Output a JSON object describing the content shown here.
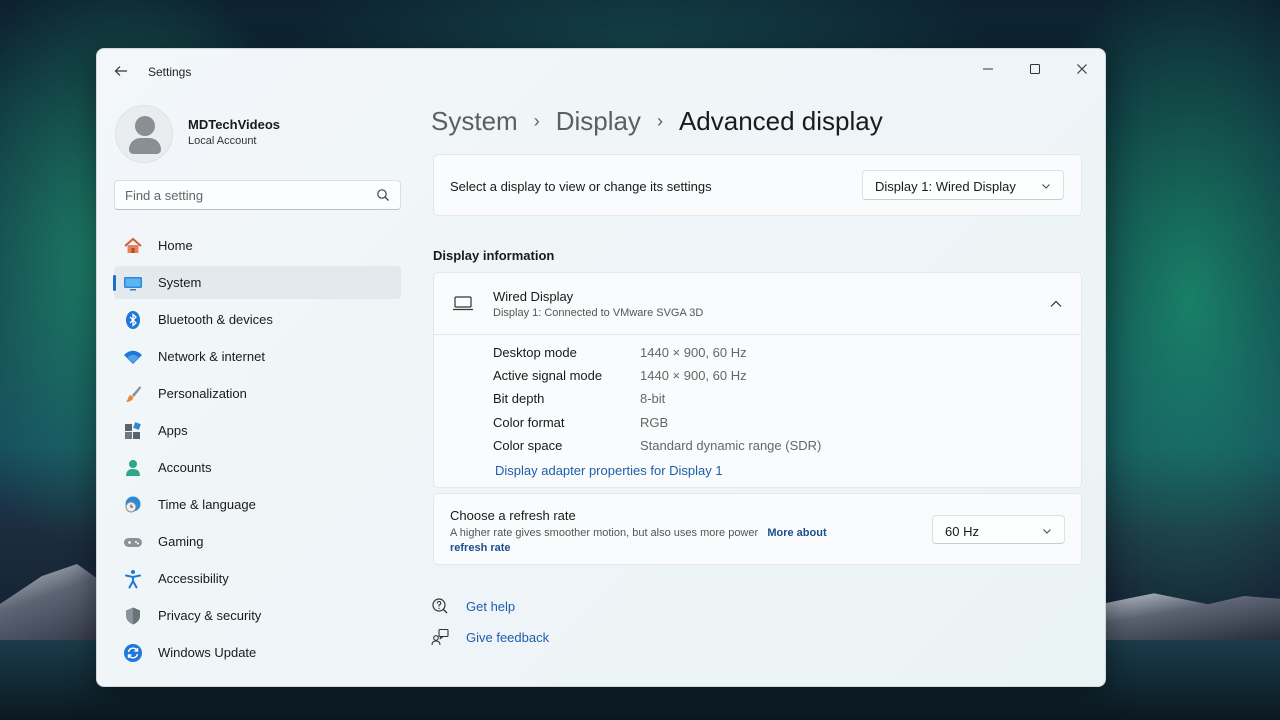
{
  "window": {
    "app_title": "Settings",
    "back_icon": "back-arrow-icon",
    "controls": [
      "minimize-icon",
      "maximize-icon",
      "close-icon"
    ]
  },
  "profile": {
    "name": "MDTechVideos",
    "account_type": "Local Account"
  },
  "search": {
    "placeholder": "Find a setting",
    "value": ""
  },
  "sidebar": {
    "active_index": 1,
    "items": [
      {
        "label": "Home",
        "icon": "home-icon"
      },
      {
        "label": "System",
        "icon": "system-monitor-icon"
      },
      {
        "label": "Bluetooth & devices",
        "icon": "bluetooth-icon"
      },
      {
        "label": "Network & internet",
        "icon": "wifi-icon"
      },
      {
        "label": "Personalization",
        "icon": "paintbrush-icon"
      },
      {
        "label": "Apps",
        "icon": "apps-icon"
      },
      {
        "label": "Accounts",
        "icon": "accounts-icon"
      },
      {
        "label": "Time & language",
        "icon": "clock-globe-icon"
      },
      {
        "label": "Gaming",
        "icon": "gamepad-icon"
      },
      {
        "label": "Accessibility",
        "icon": "accessibility-icon"
      },
      {
        "label": "Privacy & security",
        "icon": "shield-icon"
      },
      {
        "label": "Windows Update",
        "icon": "update-icon"
      }
    ]
  },
  "breadcrumb": {
    "items": [
      "System",
      "Display",
      "Advanced display"
    ],
    "separator": "›"
  },
  "display_select": {
    "label": "Select a display to view or change its settings",
    "value": "Display 1: Wired Display"
  },
  "display_info": {
    "section_title": "Display information",
    "title": "Wired Display",
    "subtitle": "Display 1: Connected to VMware SVGA 3D",
    "expanded": true,
    "rows": [
      {
        "key": "Desktop mode",
        "value": "1440 × 900, 60 Hz"
      },
      {
        "key": "Active signal mode",
        "value": "1440 × 900, 60 Hz"
      },
      {
        "key": "Bit depth",
        "value": "8-bit"
      },
      {
        "key": "Color format",
        "value": "RGB"
      },
      {
        "key": "Color space",
        "value": "Standard dynamic range (SDR)"
      }
    ],
    "adapter_link": "Display adapter properties for Display 1"
  },
  "refresh_rate": {
    "title": "Choose a refresh rate",
    "description": "A higher rate gives smoother motion, but also uses more power",
    "more_link_line1": "More about",
    "more_link_line2": "refresh rate",
    "value": "60 Hz"
  },
  "help": {
    "get_help": "Get help",
    "give_feedback": "Give feedback"
  },
  "colors": {
    "accent": "#1f6fc6",
    "link": "#1c5fad"
  }
}
